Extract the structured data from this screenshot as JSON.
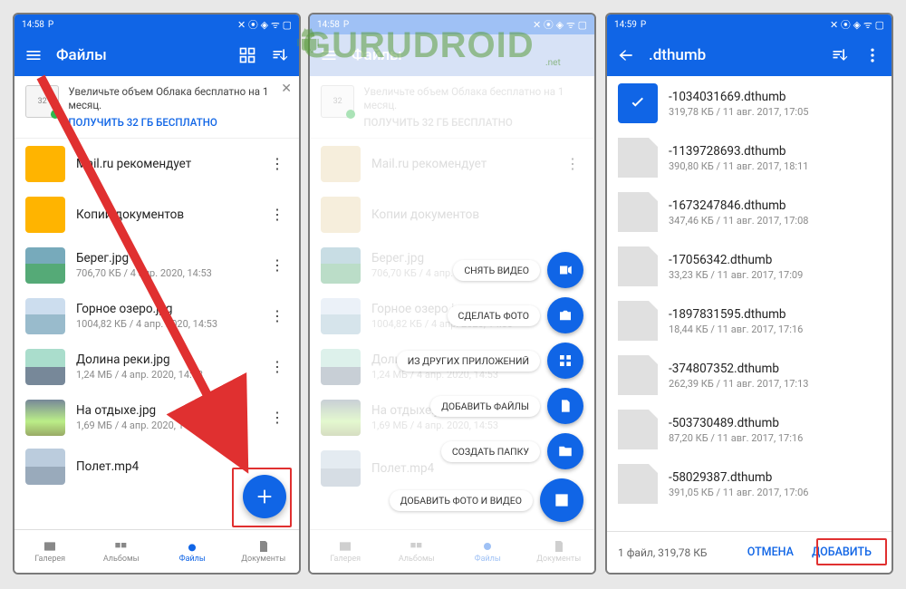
{
  "status": {
    "time": "14:58",
    "time3": "14:59",
    "icon_label": "P"
  },
  "colors": {
    "primary": "#1065e6",
    "accent_red": "#e03030"
  },
  "screen1": {
    "title": "Файлы",
    "promo_line": "Увеличьте объем Облака бесплатно на 1 месяц.",
    "promo_cta": "ПОЛУЧИТЬ 32 ГБ БЕСПЛАТНО",
    "promo_card_num": "32",
    "items": [
      {
        "name": "Mail.ru рекомендует",
        "meta": ""
      },
      {
        "name": "Копии документов",
        "meta": ""
      },
      {
        "name": "Берег.jpg",
        "meta": "706,70 КБ / 4 апр. 2020, 14:53"
      },
      {
        "name": "Горное озеро.jpg",
        "meta": "1004,82 КБ / 4 апр. 2020, 14:53"
      },
      {
        "name": "Долина реки.jpg",
        "meta": "1,24 МБ / 4 апр. 2020, 14:53"
      },
      {
        "name": "На отдыхе.jpg",
        "meta": "1,69 МБ / 4 апр. 2020, 14:53"
      },
      {
        "name": "Полет.mp4",
        "meta": ""
      }
    ],
    "nav": {
      "gallery": "Галерея",
      "albums": "Альбомы",
      "files": "Файлы",
      "docs": "Документы"
    }
  },
  "screen2": {
    "fab_actions": [
      {
        "label": "СНЯТЬ ВИДЕО",
        "icon": "video"
      },
      {
        "label": "СДЕЛАТЬ ФОТО",
        "icon": "camera"
      },
      {
        "label": "ИЗ ДРУГИХ ПРИЛОЖЕНИЙ",
        "icon": "apps"
      },
      {
        "label": "ДОБАВИТЬ ФАЙЛЫ",
        "icon": "file"
      },
      {
        "label": "СОЗДАТЬ ПАПКУ",
        "icon": "folder"
      },
      {
        "label": "ДОБАВИТЬ ФОТО И ВИДЕО",
        "icon": "image"
      }
    ]
  },
  "screen3": {
    "title": ".dthumb",
    "items": [
      {
        "name": "-1034031669.dthumb",
        "meta": "319,78 КБ / 11 авг. 2017, 17:05",
        "selected": true
      },
      {
        "name": "-1139728693.dthumb",
        "meta": "390,80 КБ / 11 авг. 2017, 18:11"
      },
      {
        "name": "-1673247846.dthumb",
        "meta": "347,46 КБ / 11 авг. 2017, 17:08"
      },
      {
        "name": "-17056342.dthumb",
        "meta": "33,23 КБ / 11 авг. 2017, 17:09"
      },
      {
        "name": "-1897831595.dthumb",
        "meta": "18,44 КБ / 11 авг. 2017, 17:16"
      },
      {
        "name": "-374807352.dthumb",
        "meta": "262,39 КБ / 11 авг. 2017, 17:13"
      },
      {
        "name": "-503730489.dthumb",
        "meta": "87,20 КБ / 11 авг. 2017, 17:16"
      },
      {
        "name": "-58029387.dthumb",
        "meta": "391,05 КБ / 11 авг. 2017, 17:06"
      }
    ],
    "footer_info": "1 файл, 319,78 КБ",
    "cancel": "ОТМЕНА",
    "add": "ДОБАВИТЬ"
  },
  "watermark": "GURUDROID",
  "watermark_sub": ".net"
}
